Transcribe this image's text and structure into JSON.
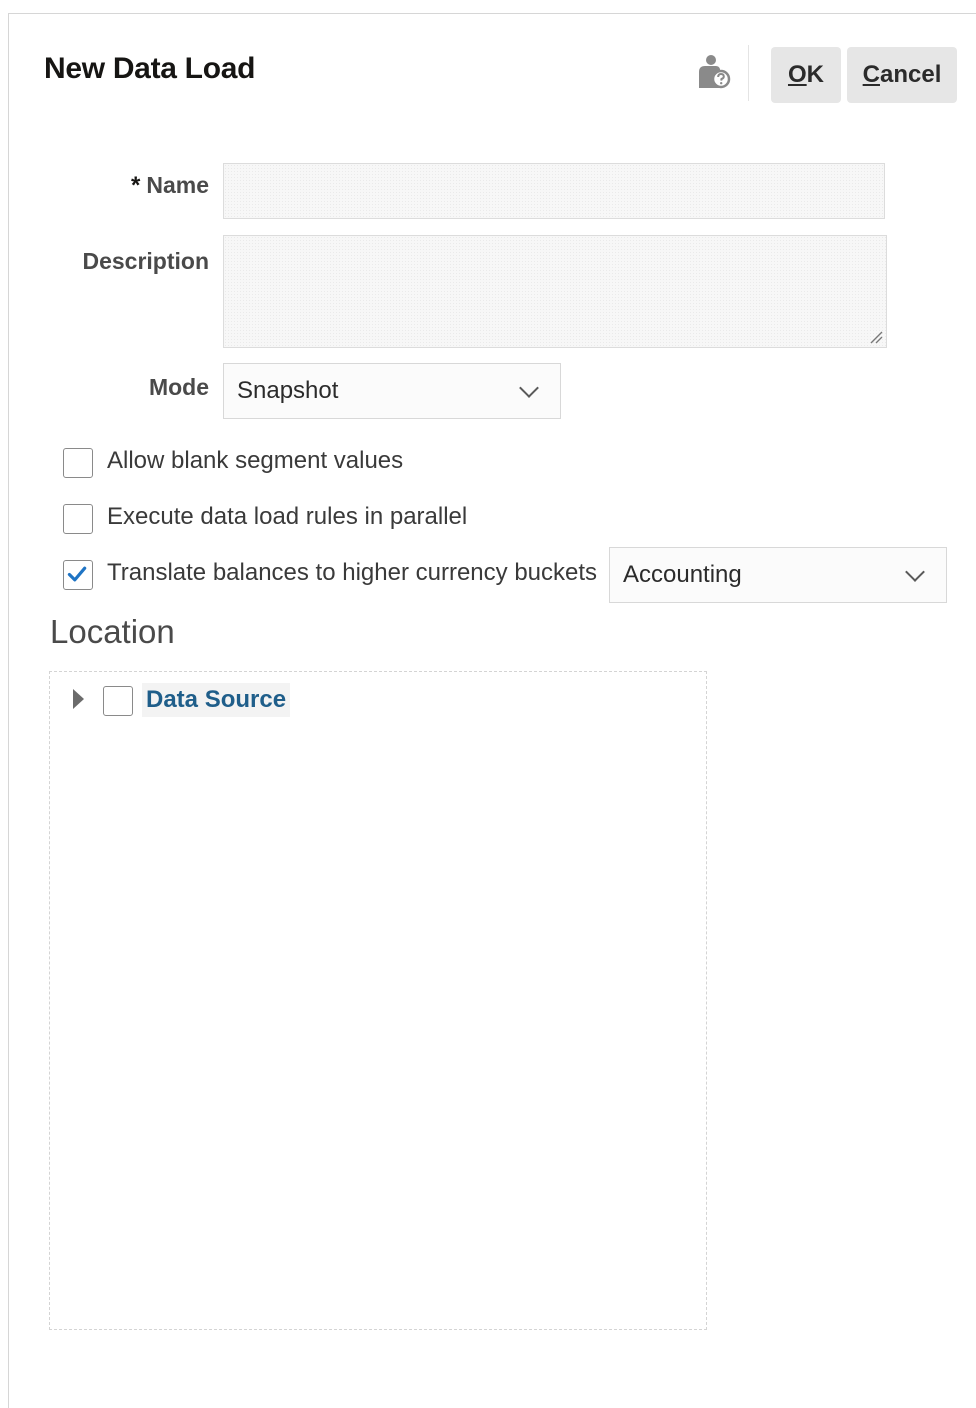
{
  "dialog": {
    "title": "New Data Load",
    "help_icon": "user-help-icon",
    "ok_access_key": "O",
    "ok_rest": "K",
    "cancel_access_key": "C",
    "cancel_rest": "ancel"
  },
  "form": {
    "name_required_mark": "*",
    "name_label": "Name",
    "name_value": "",
    "description_label": "Description",
    "description_value": "",
    "mode_label": "Mode",
    "mode_value": "Snapshot"
  },
  "options": [
    {
      "label": "Allow blank segment values",
      "checked": false
    },
    {
      "label": "Execute data load rules in parallel",
      "checked": false
    },
    {
      "label": "Translate balances to higher currency buckets",
      "checked": true
    }
  ],
  "currency_bucket": {
    "value": "Accounting"
  },
  "location": {
    "title": "Location",
    "tree": [
      {
        "label": "Data Source",
        "expanded": false,
        "checked": false
      }
    ]
  },
  "colors": {
    "accent": "#1f74c4",
    "link": "#1f5e8a"
  }
}
